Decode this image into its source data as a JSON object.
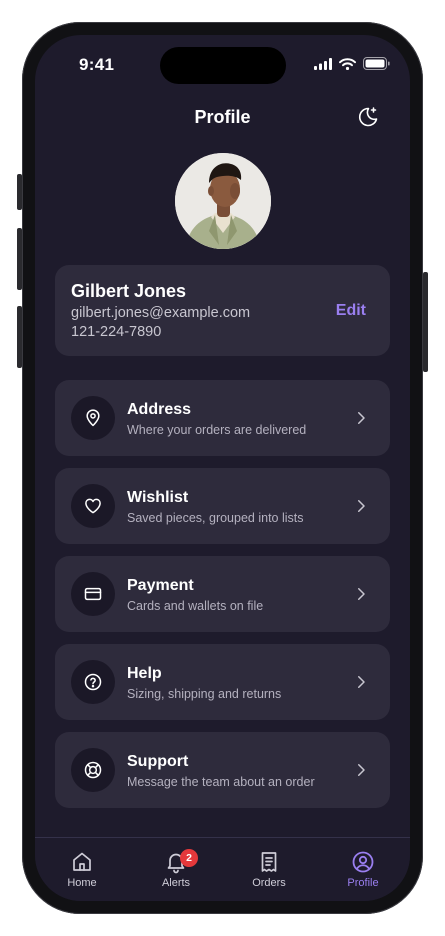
{
  "status_bar": {
    "time": "9:41"
  },
  "header": {
    "title": "Profile",
    "theme_icon": "moon-sparkle-icon"
  },
  "user": {
    "name": "Gilbert Jones",
    "email": "gilbert.jones@example.com",
    "phone": "121-224-7890",
    "edit_label": "Edit"
  },
  "menu": [
    {
      "title": "Address",
      "subtitle": "Where your orders are delivered",
      "icon": "map-pin-icon"
    },
    {
      "title": "Wishlist",
      "subtitle": "Saved pieces, grouped into lists",
      "icon": "heart-icon"
    },
    {
      "title": "Payment",
      "subtitle": "Cards and wallets on file",
      "icon": "credit-card-icon"
    },
    {
      "title": "Help",
      "subtitle": "Sizing, shipping and returns",
      "icon": "question-circle-icon"
    },
    {
      "title": "Support",
      "subtitle": "Message the team about an order",
      "icon": "lifebuoy-icon"
    }
  ],
  "tabs": [
    {
      "label": "Home",
      "icon": "home-icon"
    },
    {
      "label": "Alerts",
      "icon": "bell-icon",
      "badge": "2"
    },
    {
      "label": "Orders",
      "icon": "receipt-icon"
    },
    {
      "label": "Profile",
      "icon": "user-circle-icon",
      "active": true
    }
  ],
  "colors": {
    "background": "#1e1b2c",
    "card": "#2e2b3c",
    "accent": "#9a7ff0",
    "badge": "#e5383b"
  }
}
